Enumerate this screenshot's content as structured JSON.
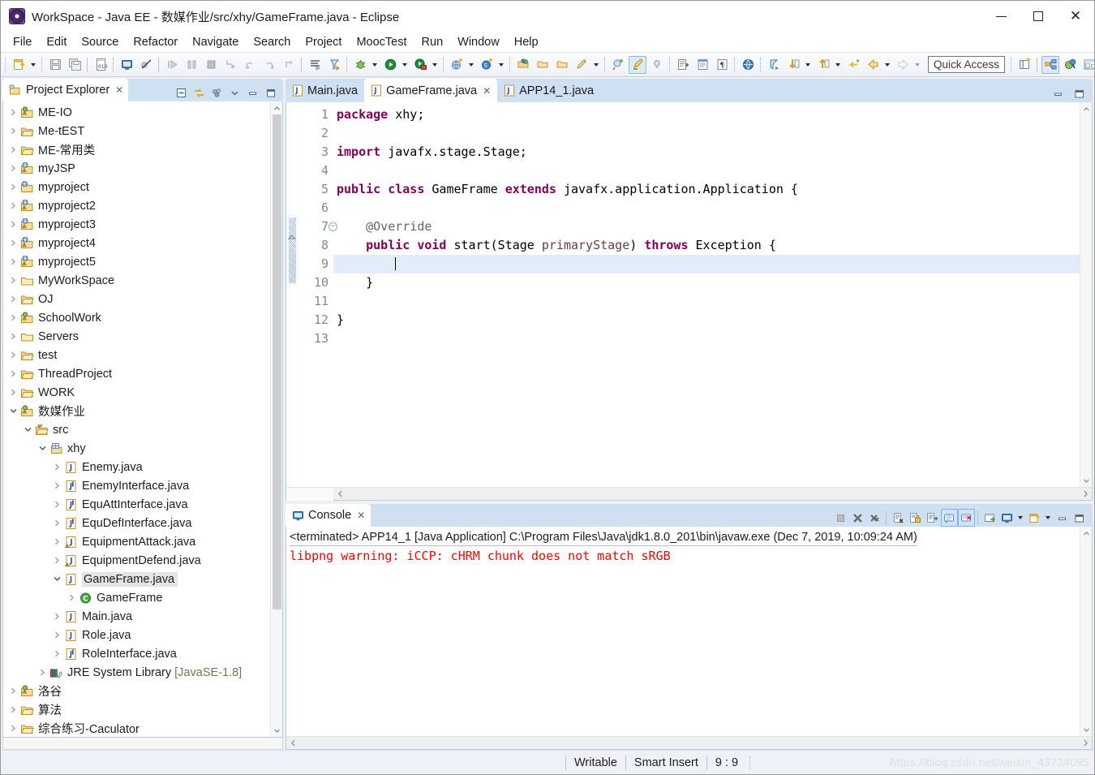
{
  "window": {
    "title": "WorkSpace - Java EE - 数媒作业/src/xhy/GameFrame.java - Eclipse",
    "minimize": "—",
    "maximize": "▢",
    "close": "✕"
  },
  "menubar": {
    "items": [
      "File",
      "Edit",
      "Source",
      "Refactor",
      "Navigate",
      "Search",
      "Project",
      "MoocTest",
      "Run",
      "Window",
      "Help"
    ]
  },
  "toolbar": {
    "quick_access": "Quick Access",
    "icons": [
      "new-wizard-icon",
      "save-icon",
      "save-all-icon",
      "new-java-class-icon",
      "open-console-icon",
      "skip-breakpoints-icon",
      "resume-icon",
      "suspend-icon",
      "terminate-icon",
      "step-into-icon",
      "step-over-icon",
      "step-return-icon",
      "drop-to-frame-icon",
      "run-last-tool-icon",
      "run-ant-icon",
      "debug-icon",
      "run-icon",
      "run-coverage-icon",
      "new-web-project-icon",
      "new-server-icon",
      "open-type-icon",
      "open-task-icon",
      "toggle-mark-occurrences-icon",
      "annotation-icon",
      "next-annotation-icon",
      "previous-annotation-icon",
      "show-whitespace-icon",
      "open-web-browser-icon",
      "search-icon",
      "next-edit-icon",
      "previous-edit-icon",
      "back-icon",
      "forward-icon",
      "new-perspective-icon",
      "java-ee-perspective-icon",
      "java-perspective-icon",
      "debug-perspective-icon"
    ]
  },
  "project_explorer": {
    "tab_label": "Project Explorer",
    "close_glyph": "✕",
    "tools": [
      "collapse-all-icon",
      "link-with-editor-icon",
      "view-menu-icon",
      "minimize-icon",
      "maximize-icon"
    ],
    "tree": [
      {
        "label": "ME-IO",
        "depth": 0,
        "icon": "java-project-warn",
        "state": "collapsed"
      },
      {
        "label": "Me-tEST",
        "depth": 0,
        "icon": "project-open",
        "state": "collapsed"
      },
      {
        "label": "ME-常用类",
        "depth": 0,
        "icon": "project-open",
        "state": "collapsed"
      },
      {
        "label": "myJSP",
        "depth": 0,
        "icon": "web-project-warn",
        "state": "collapsed"
      },
      {
        "label": "myproject",
        "depth": 0,
        "icon": "web-project",
        "state": "collapsed"
      },
      {
        "label": "myproject2",
        "depth": 0,
        "icon": "web-project-warn",
        "state": "collapsed"
      },
      {
        "label": "myproject3",
        "depth": 0,
        "icon": "web-project-warn",
        "state": "collapsed"
      },
      {
        "label": "myproject4",
        "depth": 0,
        "icon": "web-project-warn",
        "state": "collapsed"
      },
      {
        "label": "myproject5",
        "depth": 0,
        "icon": "web-project-warn",
        "state": "collapsed"
      },
      {
        "label": "MyWorkSpace",
        "depth": 0,
        "icon": "folder-plain",
        "state": "collapsed"
      },
      {
        "label": "OJ",
        "depth": 0,
        "icon": "project-open",
        "state": "collapsed"
      },
      {
        "label": "SchoolWork",
        "depth": 0,
        "icon": "java-project-warn",
        "state": "collapsed"
      },
      {
        "label": "Servers",
        "depth": 0,
        "icon": "folder-plain",
        "state": "collapsed"
      },
      {
        "label": "test",
        "depth": 0,
        "icon": "project-open",
        "state": "collapsed"
      },
      {
        "label": "ThreadProject",
        "depth": 0,
        "icon": "project-open",
        "state": "collapsed"
      },
      {
        "label": "WORK",
        "depth": 0,
        "icon": "project-open",
        "state": "collapsed"
      },
      {
        "label": "数媒作业",
        "depth": 0,
        "icon": "java-project-warn",
        "state": "expanded"
      },
      {
        "label": "src",
        "depth": 1,
        "icon": "source-folder",
        "state": "expanded"
      },
      {
        "label": "xhy",
        "depth": 2,
        "icon": "package",
        "state": "expanded"
      },
      {
        "label": "Enemy.java",
        "depth": 3,
        "icon": "java-file",
        "state": "collapsed"
      },
      {
        "label": "EnemyInterface.java",
        "depth": 3,
        "icon": "java-interface-file",
        "state": "collapsed"
      },
      {
        "label": "EquAttInterface.java",
        "depth": 3,
        "icon": "java-interface-file",
        "state": "collapsed"
      },
      {
        "label": "EquDefInterface.java",
        "depth": 3,
        "icon": "java-interface-file",
        "state": "collapsed"
      },
      {
        "label": "EquipmentAttack.java",
        "depth": 3,
        "icon": "java-file-warn",
        "state": "collapsed"
      },
      {
        "label": "EquipmentDefend.java",
        "depth": 3,
        "icon": "java-file-warn",
        "state": "collapsed"
      },
      {
        "label": "GameFrame.java",
        "depth": 3,
        "icon": "java-file",
        "state": "expanded",
        "selected": true
      },
      {
        "label": "GameFrame",
        "depth": 4,
        "icon": "class-green",
        "state": "collapsed"
      },
      {
        "label": "Main.java",
        "depth": 3,
        "icon": "java-file",
        "state": "collapsed"
      },
      {
        "label": "Role.java",
        "depth": 3,
        "icon": "java-file",
        "state": "collapsed"
      },
      {
        "label": "RoleInterface.java",
        "depth": 3,
        "icon": "java-interface-file",
        "state": "collapsed"
      },
      {
        "label": "JRE System Library ",
        "suffix": "[JavaSE-1.8]",
        "depth": 2,
        "icon": "library",
        "state": "collapsed"
      },
      {
        "label": "洛谷",
        "depth": 0,
        "icon": "java-project-warn",
        "state": "collapsed"
      },
      {
        "label": "算法",
        "depth": 0,
        "icon": "project-open",
        "state": "collapsed"
      },
      {
        "label": "综合练习-Caculator",
        "depth": 0,
        "icon": "project-open",
        "state": "collapsed"
      }
    ]
  },
  "editor": {
    "tabs": [
      {
        "label": "Main.java",
        "active": false,
        "closable": false
      },
      {
        "label": "GameFrame.java",
        "active": true,
        "closable": true,
        "close_glyph": "✕"
      },
      {
        "label": "APP14_1.java",
        "active": false,
        "closable": false
      }
    ],
    "tools": [
      "minimize-icon",
      "maximize-icon"
    ],
    "current_line": 9,
    "lines": [
      {
        "n": 1,
        "fold": false,
        "tokens": [
          {
            "t": "package",
            "c": "kw"
          },
          {
            "t": " xhy;",
            "c": ""
          }
        ]
      },
      {
        "n": 2,
        "fold": false,
        "tokens": []
      },
      {
        "n": 3,
        "fold": false,
        "tokens": [
          {
            "t": "import",
            "c": "kw"
          },
          {
            "t": " javafx.stage.Stage;",
            "c": ""
          }
        ]
      },
      {
        "n": 4,
        "fold": false,
        "tokens": []
      },
      {
        "n": 5,
        "fold": false,
        "tokens": [
          {
            "t": "public class",
            "c": "kw"
          },
          {
            "t": " GameFrame ",
            "c": ""
          },
          {
            "t": "extends",
            "c": "kw"
          },
          {
            "t": " javafx.application.Application {",
            "c": ""
          }
        ]
      },
      {
        "n": 6,
        "fold": false,
        "tokens": []
      },
      {
        "n": 7,
        "fold": true,
        "tokens": [
          {
            "t": "    @Override",
            "c": "ann"
          }
        ]
      },
      {
        "n": 8,
        "fold": false,
        "tokens": [
          {
            "t": "    ",
            "c": ""
          },
          {
            "t": "public void",
            "c": "kw"
          },
          {
            "t": " start(Stage ",
            "c": ""
          },
          {
            "t": "primaryStage",
            "c": "param"
          },
          {
            "t": ") ",
            "c": ""
          },
          {
            "t": "throws",
            "c": "kw"
          },
          {
            "t": " Exception {",
            "c": ""
          }
        ]
      },
      {
        "n": 9,
        "fold": false,
        "tokens": [
          {
            "t": "        ",
            "c": ""
          }
        ],
        "caret": true
      },
      {
        "n": 10,
        "fold": false,
        "tokens": [
          {
            "t": "    }",
            "c": ""
          }
        ]
      },
      {
        "n": 11,
        "fold": false,
        "tokens": []
      },
      {
        "n": 12,
        "fold": false,
        "tokens": [
          {
            "t": "}",
            "c": ""
          }
        ]
      },
      {
        "n": 13,
        "fold": false,
        "tokens": []
      }
    ]
  },
  "console": {
    "tab_label": "Console",
    "close_glyph": "✕",
    "header": "<terminated> APP14_1 [Java Application] C:\\Program Files\\Java\\jdk1.8.0_201\\bin\\javaw.exe (Dec 7, 2019, 10:09:24 AM)",
    "output": "libpng warning: iCCP: cHRM chunk does not match sRGB",
    "output_color": "#ff0000",
    "tools": [
      "terminate-icon",
      "remove-launch-icon",
      "remove-all-terminated-icon",
      "clear-console-icon",
      "lock-scroll-icon",
      "show-console-on-output-icon",
      "pin-console-icon",
      "display-selected-console-icon",
      "open-console-icon",
      "new-console-view-icon",
      "minimize-icon",
      "maximize-icon"
    ]
  },
  "statusbar": {
    "writable": "Writable",
    "insert_mode": "Smart Insert",
    "position": "9 : 9",
    "watermark": "https://blog.csdn.net/weixin_43734095"
  },
  "colors": {
    "tab_active_bg": "#ffffff",
    "tab_strip_bg": "#cfe0f2",
    "keyword": "#7f0055",
    "annotation": "#646464",
    "parameter": "#6a3e3e",
    "current_line": "#e2edf9",
    "selection": "#e4e4e4",
    "console_error": "#ff0000",
    "library_dim": "#7d7058"
  }
}
